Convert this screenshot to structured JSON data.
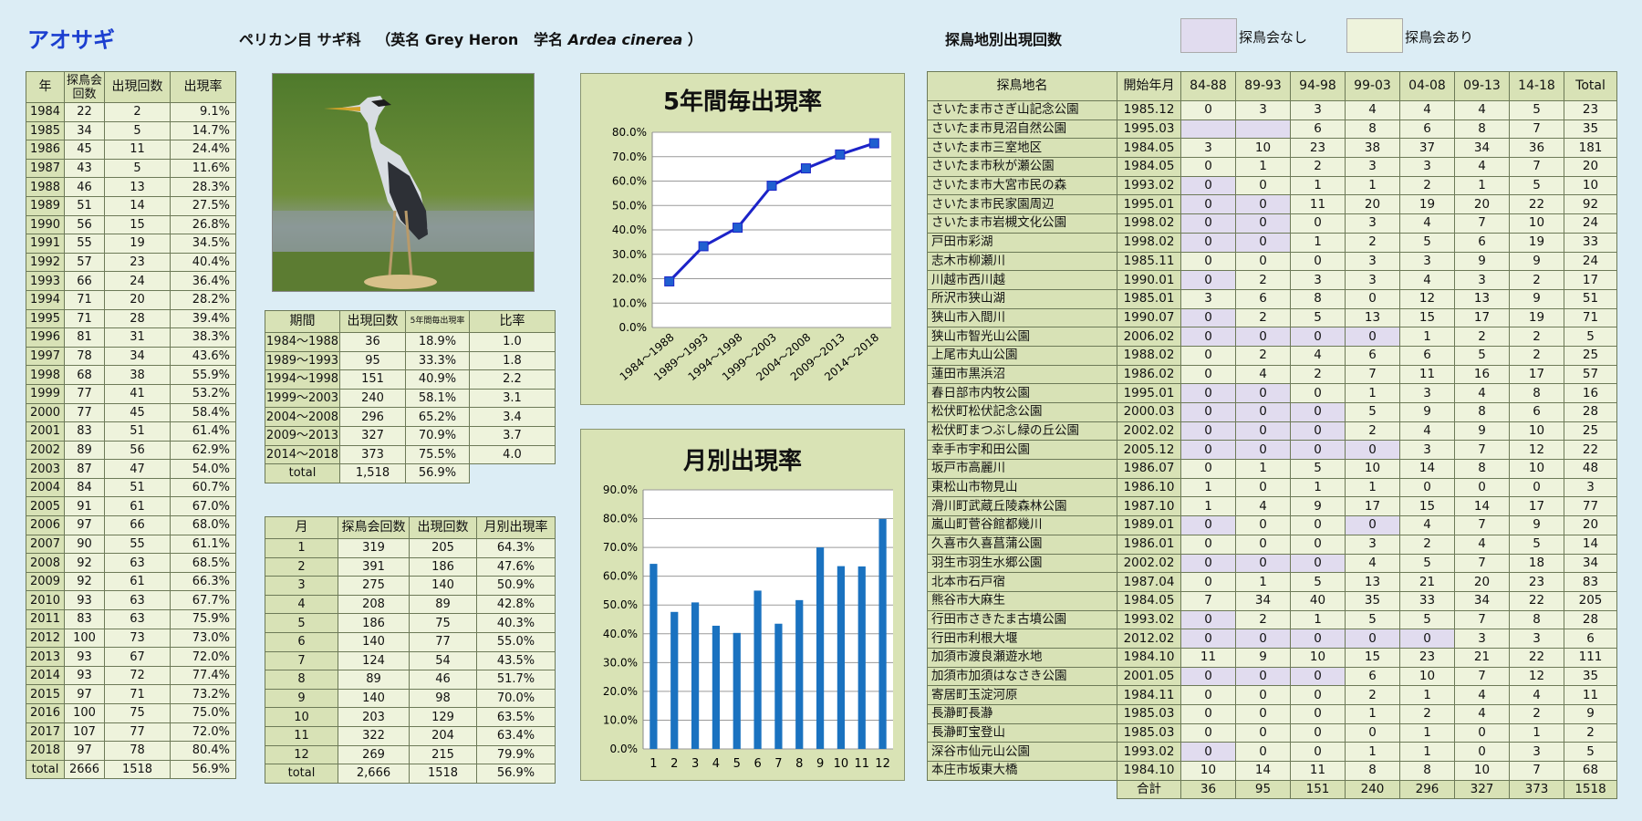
{
  "header": {
    "species": "アオサギ",
    "order_family": "ペリカン目 サギ科",
    "english_label": "（英名 Grey Heron",
    "sci_label": "学名",
    "sci_name": "Ardea cinerea",
    "sci_close": "）",
    "sites_heading": "探鳥地別出現回数",
    "legend_none": "探鳥会なし",
    "legend_yes": "探鳥会あり"
  },
  "colors": {
    "no_event": "#e1dcef",
    "event": "#eef3dc",
    "header_cell": "#d8e2b6",
    "line_series": "#1c23c8",
    "bar_series": "#1a72c0",
    "title": "#1c3fd0"
  },
  "year_table": {
    "headers": [
      "年",
      "探鳥会\n回数",
      "出現回数",
      "出現率"
    ],
    "rows": [
      [
        "1984",
        "22",
        "2",
        "9.1%"
      ],
      [
        "1985",
        "34",
        "5",
        "14.7%"
      ],
      [
        "1986",
        "45",
        "11",
        "24.4%"
      ],
      [
        "1987",
        "43",
        "5",
        "11.6%"
      ],
      [
        "1988",
        "46",
        "13",
        "28.3%"
      ],
      [
        "1989",
        "51",
        "14",
        "27.5%"
      ],
      [
        "1990",
        "56",
        "15",
        "26.8%"
      ],
      [
        "1991",
        "55",
        "19",
        "34.5%"
      ],
      [
        "1992",
        "57",
        "23",
        "40.4%"
      ],
      [
        "1993",
        "66",
        "24",
        "36.4%"
      ],
      [
        "1994",
        "71",
        "20",
        "28.2%"
      ],
      [
        "1995",
        "71",
        "28",
        "39.4%"
      ],
      [
        "1996",
        "81",
        "31",
        "38.3%"
      ],
      [
        "1997",
        "78",
        "34",
        "43.6%"
      ],
      [
        "1998",
        "68",
        "38",
        "55.9%"
      ],
      [
        "1999",
        "77",
        "41",
        "53.2%"
      ],
      [
        "2000",
        "77",
        "45",
        "58.4%"
      ],
      [
        "2001",
        "83",
        "51",
        "61.4%"
      ],
      [
        "2002",
        "89",
        "56",
        "62.9%"
      ],
      [
        "2003",
        "87",
        "47",
        "54.0%"
      ],
      [
        "2004",
        "84",
        "51",
        "60.7%"
      ],
      [
        "2005",
        "91",
        "61",
        "67.0%"
      ],
      [
        "2006",
        "97",
        "66",
        "68.0%"
      ],
      [
        "2007",
        "90",
        "55",
        "61.1%"
      ],
      [
        "2008",
        "92",
        "63",
        "68.5%"
      ],
      [
        "2009",
        "92",
        "61",
        "66.3%"
      ],
      [
        "2010",
        "93",
        "63",
        "67.7%"
      ],
      [
        "2011",
        "83",
        "63",
        "75.9%"
      ],
      [
        "2012",
        "100",
        "73",
        "73.0%"
      ],
      [
        "2013",
        "93",
        "67",
        "72.0%"
      ],
      [
        "2014",
        "93",
        "72",
        "77.4%"
      ],
      [
        "2015",
        "97",
        "71",
        "73.2%"
      ],
      [
        "2016",
        "100",
        "75",
        "75.0%"
      ],
      [
        "2017",
        "107",
        "77",
        "72.0%"
      ],
      [
        "2018",
        "97",
        "78",
        "80.4%"
      ]
    ],
    "total": [
      "total",
      "2666",
      "1518",
      "56.9%"
    ]
  },
  "period_table": {
    "headers": [
      "期間",
      "出現回数",
      "5年間毎出現率",
      "比率"
    ],
    "rows": [
      [
        "1984～1988",
        "36",
        "18.9%",
        "1.0"
      ],
      [
        "1989～1993",
        "95",
        "33.3%",
        "1.8"
      ],
      [
        "1994～1998",
        "151",
        "40.9%",
        "2.2"
      ],
      [
        "1999～2003",
        "240",
        "58.1%",
        "3.1"
      ],
      [
        "2004～2008",
        "296",
        "65.2%",
        "3.4"
      ],
      [
        "2009～2013",
        "327",
        "70.9%",
        "3.7"
      ],
      [
        "2014～2018",
        "373",
        "75.5%",
        "4.0"
      ]
    ],
    "total": [
      "total",
      "1,518",
      "56.9%"
    ]
  },
  "month_table": {
    "headers": [
      "月",
      "探鳥会回数",
      "出現回数",
      "月別出現率"
    ],
    "rows": [
      [
        "1",
        "319",
        "205",
        "64.3%"
      ],
      [
        "2",
        "391",
        "186",
        "47.6%"
      ],
      [
        "3",
        "275",
        "140",
        "50.9%"
      ],
      [
        "4",
        "208",
        "89",
        "42.8%"
      ],
      [
        "5",
        "186",
        "75",
        "40.3%"
      ],
      [
        "6",
        "140",
        "77",
        "55.0%"
      ],
      [
        "7",
        "124",
        "54",
        "43.5%"
      ],
      [
        "8",
        "89",
        "46",
        "51.7%"
      ],
      [
        "9",
        "140",
        "98",
        "70.0%"
      ],
      [
        "10",
        "203",
        "129",
        "63.5%"
      ],
      [
        "11",
        "322",
        "204",
        "63.4%"
      ],
      [
        "12",
        "269",
        "215",
        "79.9%"
      ]
    ],
    "total": [
      "total",
      "2,666",
      "1518",
      "56.9%"
    ]
  },
  "site_table": {
    "headers": [
      "探鳥地名",
      "開始年月",
      "84-88",
      "89-93",
      "94-98",
      "99-03",
      "04-08",
      "09-13",
      "14-18",
      "Total"
    ],
    "rows": [
      {
        "name": "さいたま市さぎ山記念公園",
        "start": "1985.12",
        "v": [
          "0",
          "3",
          "3",
          "4",
          "4",
          "4",
          "5",
          "23"
        ],
        "none": []
      },
      {
        "name": "さいたま市見沼自然公園",
        "start": "1995.03",
        "v": [
          "",
          "",
          "6",
          "8",
          "6",
          "8",
          "7",
          "35"
        ],
        "none": [
          0,
          1
        ]
      },
      {
        "name": "さいたま市三室地区",
        "start": "1984.05",
        "v": [
          "3",
          "10",
          "23",
          "38",
          "37",
          "34",
          "36",
          "181"
        ],
        "none": []
      },
      {
        "name": "さいたま市秋が瀬公園",
        "start": "1984.05",
        "v": [
          "0",
          "1",
          "2",
          "3",
          "3",
          "4",
          "7",
          "20"
        ],
        "none": []
      },
      {
        "name": "さいたま市大宮市民の森",
        "start": "1993.02",
        "v": [
          "0",
          "0",
          "1",
          "1",
          "2",
          "1",
          "5",
          "10"
        ],
        "none": [
          0
        ]
      },
      {
        "name": "さいたま市民家園周辺",
        "start": "1995.01",
        "v": [
          "0",
          "0",
          "11",
          "20",
          "19",
          "20",
          "22",
          "92"
        ],
        "none": [
          0,
          1
        ]
      },
      {
        "name": "さいたま市岩槻文化公園",
        "start": "1998.02",
        "v": [
          "0",
          "0",
          "0",
          "3",
          "4",
          "7",
          "10",
          "24"
        ],
        "none": [
          0,
          1
        ]
      },
      {
        "name": "戸田市彩湖",
        "start": "1998.02",
        "v": [
          "0",
          "0",
          "1",
          "2",
          "5",
          "6",
          "19",
          "33"
        ],
        "none": [
          0,
          1
        ]
      },
      {
        "name": "志木市柳瀬川",
        "start": "1985.11",
        "v": [
          "0",
          "0",
          "0",
          "3",
          "3",
          "9",
          "9",
          "24"
        ],
        "none": []
      },
      {
        "name": "川越市西川越",
        "start": "1990.01",
        "v": [
          "0",
          "2",
          "3",
          "3",
          "4",
          "3",
          "2",
          "17"
        ],
        "none": [
          0
        ]
      },
      {
        "name": "所沢市狭山湖",
        "start": "1985.01",
        "v": [
          "3",
          "6",
          "8",
          "0",
          "12",
          "13",
          "9",
          "51"
        ],
        "none": []
      },
      {
        "name": "狭山市入間川",
        "start": "1990.07",
        "v": [
          "0",
          "2",
          "5",
          "13",
          "15",
          "17",
          "19",
          "71"
        ],
        "none": [
          0
        ]
      },
      {
        "name": "狭山市智光山公園",
        "start": "2006.02",
        "v": [
          "0",
          "0",
          "0",
          "0",
          "1",
          "2",
          "2",
          "5"
        ],
        "none": [
          0,
          1,
          2,
          3
        ]
      },
      {
        "name": "上尾市丸山公園",
        "start": "1988.02",
        "v": [
          "0",
          "2",
          "4",
          "6",
          "6",
          "5",
          "2",
          "25"
        ],
        "none": []
      },
      {
        "name": "蓮田市黒浜沼",
        "start": "1986.02",
        "v": [
          "0",
          "4",
          "2",
          "7",
          "11",
          "16",
          "17",
          "57"
        ],
        "none": []
      },
      {
        "name": "春日部市内牧公園",
        "start": "1995.01",
        "v": [
          "0",
          "0",
          "0",
          "1",
          "3",
          "4",
          "8",
          "16"
        ],
        "none": [
          0,
          1
        ]
      },
      {
        "name": "松伏町松伏記念公園",
        "start": "2000.03",
        "v": [
          "0",
          "0",
          "0",
          "5",
          "9",
          "8",
          "6",
          "28"
        ],
        "none": [
          0,
          1,
          2
        ]
      },
      {
        "name": "松伏町まつぶし緑の丘公園",
        "start": "2002.02",
        "v": [
          "0",
          "0",
          "0",
          "2",
          "4",
          "9",
          "10",
          "25"
        ],
        "none": [
          0,
          1,
          2
        ]
      },
      {
        "name": "幸手市宇和田公園",
        "start": "2005.12",
        "v": [
          "0",
          "0",
          "0",
          "0",
          "3",
          "7",
          "12",
          "22"
        ],
        "none": [
          0,
          1,
          2,
          3
        ]
      },
      {
        "name": "坂戸市高麗川",
        "start": "1986.07",
        "v": [
          "0",
          "1",
          "5",
          "10",
          "14",
          "8",
          "10",
          "48"
        ],
        "none": []
      },
      {
        "name": "東松山市物見山",
        "start": "1986.10",
        "v": [
          "1",
          "0",
          "1",
          "1",
          "0",
          "0",
          "0",
          "3"
        ],
        "none": []
      },
      {
        "name": "滑川町武蔵丘陵森林公園",
        "start": "1987.10",
        "v": [
          "1",
          "4",
          "9",
          "17",
          "15",
          "14",
          "17",
          "77"
        ],
        "none": []
      },
      {
        "name": "嵐山町菅谷館都幾川",
        "start": "1989.01",
        "v": [
          "0",
          "0",
          "0",
          "0",
          "4",
          "7",
          "9",
          "20"
        ],
        "none": [
          0,
          3
        ]
      },
      {
        "name": "久喜市久喜菖蒲公園",
        "start": "1986.01",
        "v": [
          "0",
          "0",
          "0",
          "3",
          "2",
          "4",
          "5",
          "14"
        ],
        "none": []
      },
      {
        "name": "羽生市羽生水郷公園",
        "start": "2002.02",
        "v": [
          "0",
          "0",
          "0",
          "4",
          "5",
          "7",
          "18",
          "34"
        ],
        "none": [
          0,
          1,
          2
        ]
      },
      {
        "name": "北本市石戸宿",
        "start": "1987.04",
        "v": [
          "0",
          "1",
          "5",
          "13",
          "21",
          "20",
          "23",
          "83"
        ],
        "none": []
      },
      {
        "name": "熊谷市大麻生",
        "start": "1984.05",
        "v": [
          "7",
          "34",
          "40",
          "35",
          "33",
          "34",
          "22",
          "205"
        ],
        "none": []
      },
      {
        "name": "行田市さきたま古墳公園",
        "start": "1993.02",
        "v": [
          "0",
          "2",
          "1",
          "5",
          "5",
          "7",
          "8",
          "28"
        ],
        "none": [
          0
        ]
      },
      {
        "name": "行田市利根大堰",
        "start": "2012.02",
        "v": [
          "0",
          "0",
          "0",
          "0",
          "0",
          "3",
          "3",
          "6"
        ],
        "none": [
          0,
          1,
          2,
          3,
          4
        ]
      },
      {
        "name": "加須市渡良瀬遊水地",
        "start": "1984.10",
        "v": [
          "11",
          "9",
          "10",
          "15",
          "23",
          "21",
          "22",
          "111"
        ],
        "none": []
      },
      {
        "name": "加須市加須はなさき公園",
        "start": "2001.05",
        "v": [
          "0",
          "0",
          "0",
          "6",
          "10",
          "7",
          "12",
          "35"
        ],
        "none": [
          0,
          1,
          2
        ]
      },
      {
        "name": "寄居町玉淀河原",
        "start": "1984.11",
        "v": [
          "0",
          "0",
          "0",
          "2",
          "1",
          "4",
          "4",
          "11"
        ],
        "none": []
      },
      {
        "name": "長瀞町長瀞",
        "start": "1985.03",
        "v": [
          "0",
          "0",
          "0",
          "1",
          "2",
          "4",
          "2",
          "9"
        ],
        "none": []
      },
      {
        "name": "長瀞町宝登山",
        "start": "1985.03",
        "v": [
          "0",
          "0",
          "0",
          "0",
          "1",
          "0",
          "1",
          "2"
        ],
        "none": []
      },
      {
        "name": "深谷市仙元山公園",
        "start": "1993.02",
        "v": [
          "0",
          "0",
          "0",
          "1",
          "1",
          "0",
          "3",
          "5"
        ],
        "none": [
          0
        ]
      },
      {
        "name": "本庄市坂東大橋",
        "start": "1984.10",
        "v": [
          "10",
          "14",
          "11",
          "8",
          "8",
          "10",
          "7",
          "68"
        ],
        "none": []
      }
    ],
    "total_label": "合計",
    "totals": [
      "36",
      "95",
      "151",
      "240",
      "296",
      "327",
      "373",
      "1518"
    ]
  },
  "chart_data": [
    {
      "type": "line",
      "title": "5年間毎出現率",
      "categories": [
        "1984～1988",
        "1989～1993",
        "1994～1998",
        "1999～2003",
        "2004～2008",
        "2009～2013",
        "2014～2018"
      ],
      "values": [
        18.9,
        33.3,
        40.9,
        58.1,
        65.2,
        70.9,
        75.5
      ],
      "ylim": [
        0,
        80
      ],
      "yticks": [
        "0.0%",
        "10.0%",
        "20.0%",
        "30.0%",
        "40.0%",
        "50.0%",
        "60.0%",
        "70.0%",
        "80.0%"
      ],
      "grid": true
    },
    {
      "type": "bar",
      "title": "月別出現率",
      "categories": [
        "1",
        "2",
        "3",
        "4",
        "5",
        "6",
        "7",
        "8",
        "9",
        "10",
        "11",
        "12"
      ],
      "values": [
        64.3,
        47.6,
        50.9,
        42.8,
        40.3,
        55.0,
        43.5,
        51.7,
        70.0,
        63.5,
        63.4,
        79.9
      ],
      "ylim": [
        0,
        90
      ],
      "yticks": [
        "0.0%",
        "10.0%",
        "20.0%",
        "30.0%",
        "40.0%",
        "50.0%",
        "60.0%",
        "70.0%",
        "80.0%",
        "90.0%"
      ],
      "grid": true
    }
  ]
}
